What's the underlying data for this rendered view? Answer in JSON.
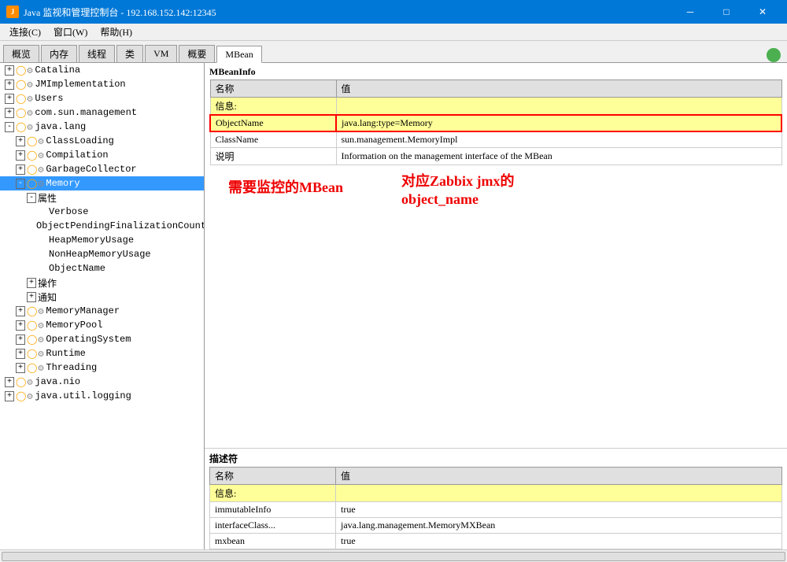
{
  "titleBar": {
    "title": "Java 监视和管理控制台 - 192.168.152.142:12345",
    "iconLabel": "J",
    "btnMinimize": "─",
    "btnMaximize": "□",
    "btnClose": "✕"
  },
  "menuBar": {
    "items": [
      "连接(C)",
      "窗口(W)",
      "帮助(H)"
    ]
  },
  "tabs": {
    "items": [
      "概览",
      "内存",
      "线程",
      "类",
      "VM",
      "概要",
      "MBean"
    ],
    "activeIndex": 6
  },
  "tree": {
    "items": [
      {
        "id": "catalina",
        "label": "Catalina",
        "indent": 0,
        "toggle": "+",
        "hasIcon": true,
        "selected": false
      },
      {
        "id": "jmimplementation",
        "label": "JMImplementation",
        "indent": 0,
        "toggle": "+",
        "hasIcon": true,
        "selected": false
      },
      {
        "id": "users",
        "label": "Users",
        "indent": 0,
        "toggle": "+",
        "hasIcon": true,
        "selected": false
      },
      {
        "id": "com.sun.management",
        "label": "com.sun.management",
        "indent": 0,
        "toggle": "+",
        "hasIcon": true,
        "selected": false
      },
      {
        "id": "java.lang",
        "label": "java.lang",
        "indent": 0,
        "toggle": "-",
        "hasIcon": true,
        "selected": false
      },
      {
        "id": "classloading",
        "label": "ClassLoading",
        "indent": 1,
        "toggle": "+",
        "hasIcon": true,
        "selected": false
      },
      {
        "id": "compilation",
        "label": "Compilation",
        "indent": 1,
        "toggle": "+",
        "hasIcon": true,
        "selected": false
      },
      {
        "id": "garbagecollector",
        "label": "GarbageCollector",
        "indent": 1,
        "toggle": "+",
        "hasIcon": true,
        "selected": false
      },
      {
        "id": "memory",
        "label": "Memory",
        "indent": 1,
        "toggle": "-",
        "hasIcon": true,
        "selected": true
      },
      {
        "id": "属性",
        "label": "属性",
        "indent": 2,
        "toggle": "-",
        "hasIcon": false,
        "selected": false
      },
      {
        "id": "verbose",
        "label": "Verbose",
        "indent": 3,
        "toggle": "",
        "hasIcon": false,
        "selected": false
      },
      {
        "id": "objectpendingfinalizationcount",
        "label": "ObjectPendingFinalizationCount",
        "indent": 3,
        "toggle": "",
        "hasIcon": false,
        "selected": false
      },
      {
        "id": "heapmemoryusage",
        "label": "HeapMemoryUsage",
        "indent": 3,
        "toggle": "",
        "hasIcon": false,
        "selected": false
      },
      {
        "id": "nonheapmemoryusage",
        "label": "NonHeapMemoryUsage",
        "indent": 3,
        "toggle": "",
        "hasIcon": false,
        "selected": false
      },
      {
        "id": "objectname",
        "label": "ObjectName",
        "indent": 3,
        "toggle": "",
        "hasIcon": false,
        "selected": false
      },
      {
        "id": "操作",
        "label": "操作",
        "indent": 2,
        "toggle": "+",
        "hasIcon": false,
        "selected": false
      },
      {
        "id": "通知",
        "label": "通知",
        "indent": 2,
        "toggle": "+",
        "hasIcon": false,
        "selected": false
      },
      {
        "id": "memorymanager",
        "label": "MemoryManager",
        "indent": 1,
        "toggle": "+",
        "hasIcon": true,
        "selected": false
      },
      {
        "id": "memorypool",
        "label": "MemoryPool",
        "indent": 1,
        "toggle": "+",
        "hasIcon": true,
        "selected": false
      },
      {
        "id": "operatingsystem",
        "label": "OperatingSystem",
        "indent": 1,
        "toggle": "+",
        "hasIcon": true,
        "selected": false
      },
      {
        "id": "runtime",
        "label": "Runtime",
        "indent": 1,
        "toggle": "+",
        "hasIcon": true,
        "selected": false
      },
      {
        "id": "threading",
        "label": "Threading",
        "indent": 1,
        "toggle": "+",
        "hasIcon": true,
        "selected": false
      },
      {
        "id": "java.nio",
        "label": "java.nio",
        "indent": 0,
        "toggle": "+",
        "hasIcon": true,
        "selected": false
      },
      {
        "id": "java.util.logging",
        "label": "java.util.logging",
        "indent": 0,
        "toggle": "+",
        "hasIcon": true,
        "selected": false
      }
    ]
  },
  "mbeanInfo": {
    "sectionLabel": "MBeanInfo",
    "tableHeaders": [
      "名称",
      "值"
    ],
    "rows": [
      {
        "name": "信息:",
        "value": "",
        "highlight": "yellow"
      },
      {
        "name": "ObjectName",
        "value": "java.lang:type=Memory",
        "highlight": "red-border"
      },
      {
        "name": "ClassName",
        "value": "sun.management.MemoryImpl",
        "highlight": "none"
      },
      {
        "name": "说明",
        "value": "Information on the management interface of the MBean",
        "highlight": "none"
      }
    ]
  },
  "annotations": {
    "mbean": "需要监控的MBean",
    "objectName": "对应Zabbix jmx的\nobject_name"
  },
  "descriptor": {
    "sectionLabel": "描述符",
    "tableHeaders": [
      "名称",
      "值"
    ],
    "rows": [
      {
        "name": "信息:",
        "value": "",
        "highlight": "yellow"
      },
      {
        "name": "immutableInfo",
        "value": "true",
        "highlight": "none"
      },
      {
        "name": "interfaceClass...",
        "value": "java.lang.management.MemoryMXBean",
        "highlight": "none"
      },
      {
        "name": "mxbean",
        "value": "true",
        "highlight": "none"
      }
    ]
  }
}
